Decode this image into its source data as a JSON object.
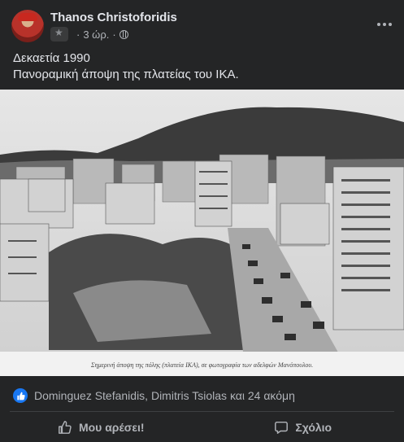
{
  "post": {
    "author": "Thanos Christoforidis",
    "time": "3 ώρ.",
    "separator": "·",
    "text_line1": "Δεκαετία 1990",
    "text_line2": "Πανοραμική άποψη της πλατείας του ΙΚΑ.",
    "photo_caption": "Σημερινή άποψη της πόλης (πλατεία ΙΚΑ), σε φωτογραφία των αδελφών Μανόπουλου."
  },
  "icons": {
    "avatar": "avatar",
    "group": "group-thumbnail-icon",
    "privacy": "globe-icon",
    "more": "more-options-icon",
    "like_reaction": "like-reaction-icon",
    "like_action": "thumbs-up-icon",
    "comment_action": "comment-icon"
  },
  "reactions": {
    "summary": "Dominguez Stefanidis, Dimitris Tsiolas και 24 ακόμη"
  },
  "actions": {
    "like_label": "Μου αρέσει!",
    "comment_label": "Σχόλιο"
  },
  "colors": {
    "background": "#242526",
    "text": "#e4e6eb",
    "secondary_text": "#b0b3b8",
    "accent": "#1877f2"
  }
}
